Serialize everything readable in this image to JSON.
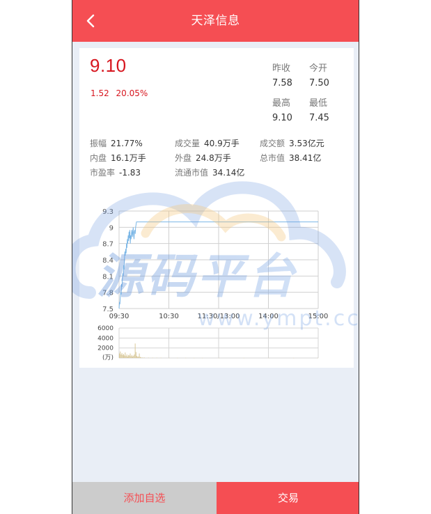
{
  "header": {
    "title": "天泽信息",
    "back_icon": "chevron-left-icon"
  },
  "quote": {
    "price": "9.10",
    "change": "1.52",
    "change_pct": "20.05%",
    "prev_close_label": "昨收",
    "prev_close": "7.58",
    "open_label": "今开",
    "open": "7.50",
    "high_label": "最高",
    "high": "9.10",
    "low_label": "最低",
    "low": "7.45"
  },
  "stats": [
    {
      "label": "振幅",
      "value": "21.77%"
    },
    {
      "label": "成交量",
      "value": "40.9万手"
    },
    {
      "label": "成交额",
      "value": "3.53亿元"
    },
    {
      "label": "内盘",
      "value": "16.1万手"
    },
    {
      "label": "外盘",
      "value": "24.8万手"
    },
    {
      "label": "总市值",
      "value": "38.41亿"
    },
    {
      "label": "市盈率",
      "value": "-1.83"
    },
    {
      "label": "流通市值",
      "value": "34.14亿"
    }
  ],
  "watermark": {
    "text": "源码平台",
    "url": "www.ympt.cc"
  },
  "chart_data": {
    "type": "line",
    "price_yticks": [
      "9.3",
      "9",
      "8.7",
      "8.4",
      "8.1",
      "7.8",
      "7.5"
    ],
    "price_ylim": [
      7.5,
      9.3
    ],
    "xticks": [
      "09:30",
      "10:30",
      "11:30/13:00",
      "14:00",
      "15:00"
    ],
    "series": [
      {
        "x": [
          0,
          0.5,
          1,
          1.5,
          2,
          2.5,
          3,
          3.5,
          4,
          4.5,
          5,
          5.5,
          6,
          6.5,
          7,
          7.5,
          8,
          8.5,
          9,
          9.5,
          10,
          10.5,
          11,
          11.5,
          12,
          12.5,
          13,
          13.5,
          14,
          14.5,
          15,
          15.5,
          16,
          16.5,
          17,
          17.5,
          18,
          18.5,
          19,
          19.5,
          20,
          20.5,
          21,
          22,
          23,
          24,
          26,
          30,
          40,
          60,
          90,
          120,
          150,
          180,
          210,
          240
        ],
        "values": [
          7.5,
          7.62,
          7.58,
          7.72,
          7.8,
          7.76,
          7.95,
          7.9,
          8.05,
          8.15,
          8.1,
          8.3,
          8.22,
          8.4,
          8.55,
          8.48,
          8.6,
          8.52,
          8.7,
          8.62,
          8.78,
          8.7,
          8.85,
          8.75,
          8.92,
          8.8,
          8.95,
          8.7,
          8.85,
          8.78,
          8.9,
          8.95,
          8.82,
          8.9,
          9.0,
          8.85,
          8.78,
          8.92,
          8.95,
          8.88,
          9.0,
          9.05,
          9.1,
          9.1,
          9.1,
          9.1,
          9.1,
          9.1,
          9.1,
          9.1,
          9.1,
          9.1,
          9.1,
          9.1,
          9.1,
          9.1
        ]
      }
    ],
    "volume_yticks": [
      "6000",
      "4000",
      "2000",
      "(万)"
    ],
    "volume_ylim": [
      0,
      6000
    ],
    "volume": {
      "x": [
        0,
        1,
        2,
        3,
        4,
        5,
        6,
        7,
        8,
        9,
        10,
        11,
        12,
        13,
        14,
        15,
        16,
        17,
        18,
        19,
        20,
        21,
        22,
        23,
        24,
        25,
        26,
        28,
        30,
        35,
        40,
        45,
        50,
        60,
        70,
        80,
        90,
        100,
        120,
        150,
        180,
        210,
        239
      ],
      "values": [
        900,
        1300,
        700,
        1000,
        600,
        800,
        500,
        1100,
        400,
        700,
        300,
        600,
        500,
        900,
        350,
        600,
        300,
        450,
        700,
        2900,
        1200,
        400,
        250,
        300,
        900,
        200,
        150,
        120,
        100,
        80,
        70,
        60,
        60,
        50,
        40,
        40,
        30,
        30,
        30,
        30,
        30,
        30,
        30
      ]
    }
  },
  "footer": {
    "add_label": "添加自选",
    "trade_label": "交易"
  },
  "colors": {
    "brand": "#f54e53",
    "up": "#d7161f",
    "line": "#7ab6e6",
    "volume": "#d8c89a"
  }
}
